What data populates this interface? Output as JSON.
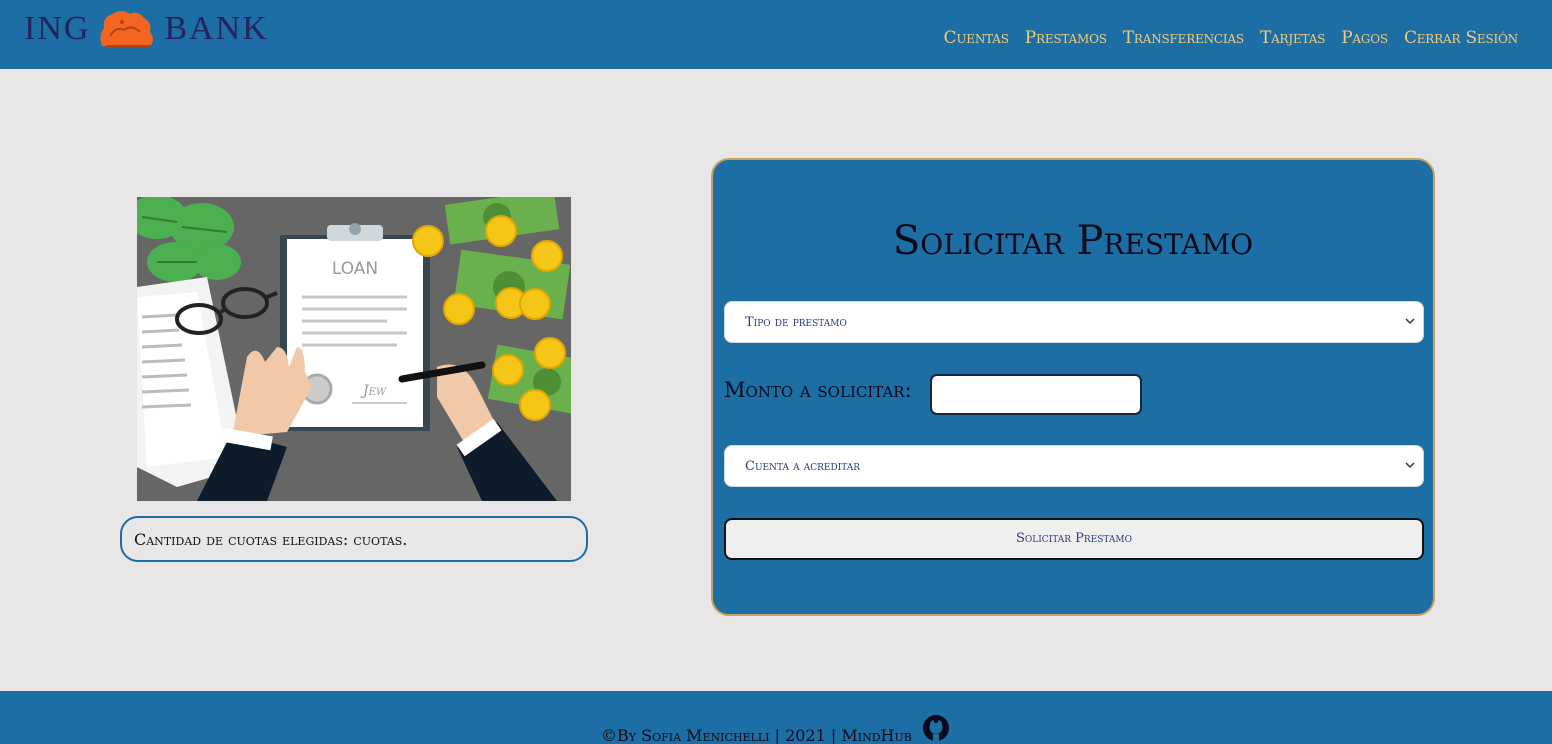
{
  "header": {
    "logo_left": "ING",
    "logo_right": "BANK",
    "nav": [
      "Cuentas",
      "Prestamos",
      "Transferencias",
      "Tarjetas",
      "Pagos",
      "Cerrar Sesión"
    ]
  },
  "illustration": {
    "doc_title": "LOAN",
    "signature": "Jew"
  },
  "cuotas_text": "Cantidad de cuotas elegidas: cuotas.",
  "form": {
    "title": "Solicitar Prestamo",
    "tipo_prestamo_selected": "Tipo de prestamo",
    "monto_label": "Monto a solicitar:",
    "monto_value": "",
    "cuenta_selected": "Cuenta a acreditar",
    "submit_label": "Solicitar Prestamo"
  },
  "footer": {
    "text": "©By Sofia Menichelli | 2021 | MindHub"
  },
  "colors": {
    "primary": "#1c6ea4",
    "nav_text": "#f1cd7c",
    "background": "#e8e6e7",
    "panel_border": "#c8a25c",
    "logo_text": "#262262",
    "lion": "#f26522"
  },
  "icons": [
    "lion-logo-icon",
    "chevron-down-icon",
    "github-icon"
  ]
}
